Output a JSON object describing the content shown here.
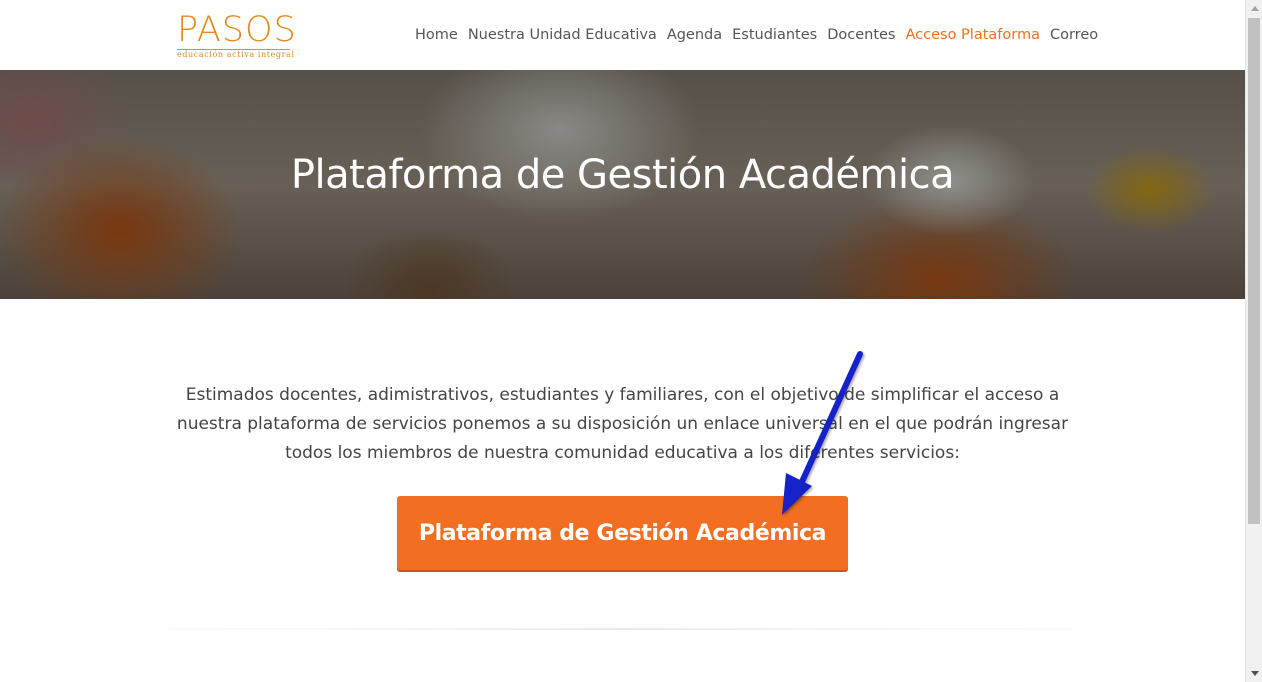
{
  "logo": {
    "wordmark": "PASOS",
    "tagline": "educación activa integral"
  },
  "nav": {
    "items": [
      {
        "label": "Home",
        "active": false
      },
      {
        "label": "Nuestra Unidad Educativa",
        "active": false
      },
      {
        "label": "Agenda",
        "active": false
      },
      {
        "label": "Estudiantes",
        "active": false
      },
      {
        "label": "Docentes",
        "active": false
      },
      {
        "label": "Acceso Plataforma",
        "active": true
      },
      {
        "label": "Correo",
        "active": false
      }
    ]
  },
  "hero": {
    "title": "Plataforma de Gestión Académica"
  },
  "main": {
    "intro_lines": [
      "Estimados docentes, adimistrativos, estudiantes y familiares, con el objetivo de simplificar el acceso a",
      "nuestra plataforma de servicios ponemos a su disposición un enlace universal en el que podrán ingresar",
      "todos los miembros de nuestra comunidad educativa a los diferentes servicios:"
    ],
    "cta_label": "Plataforma de Gestión Académica"
  },
  "colors": {
    "brand_orange": "#e98a1d",
    "accent": "#f26f21",
    "arrow": "#1422c8"
  },
  "icons": {
    "annotation": "arrow-pointer-icon",
    "scroll_up": "scroll-up-arrow-icon",
    "scroll_down": "scroll-down-arrow-icon"
  }
}
